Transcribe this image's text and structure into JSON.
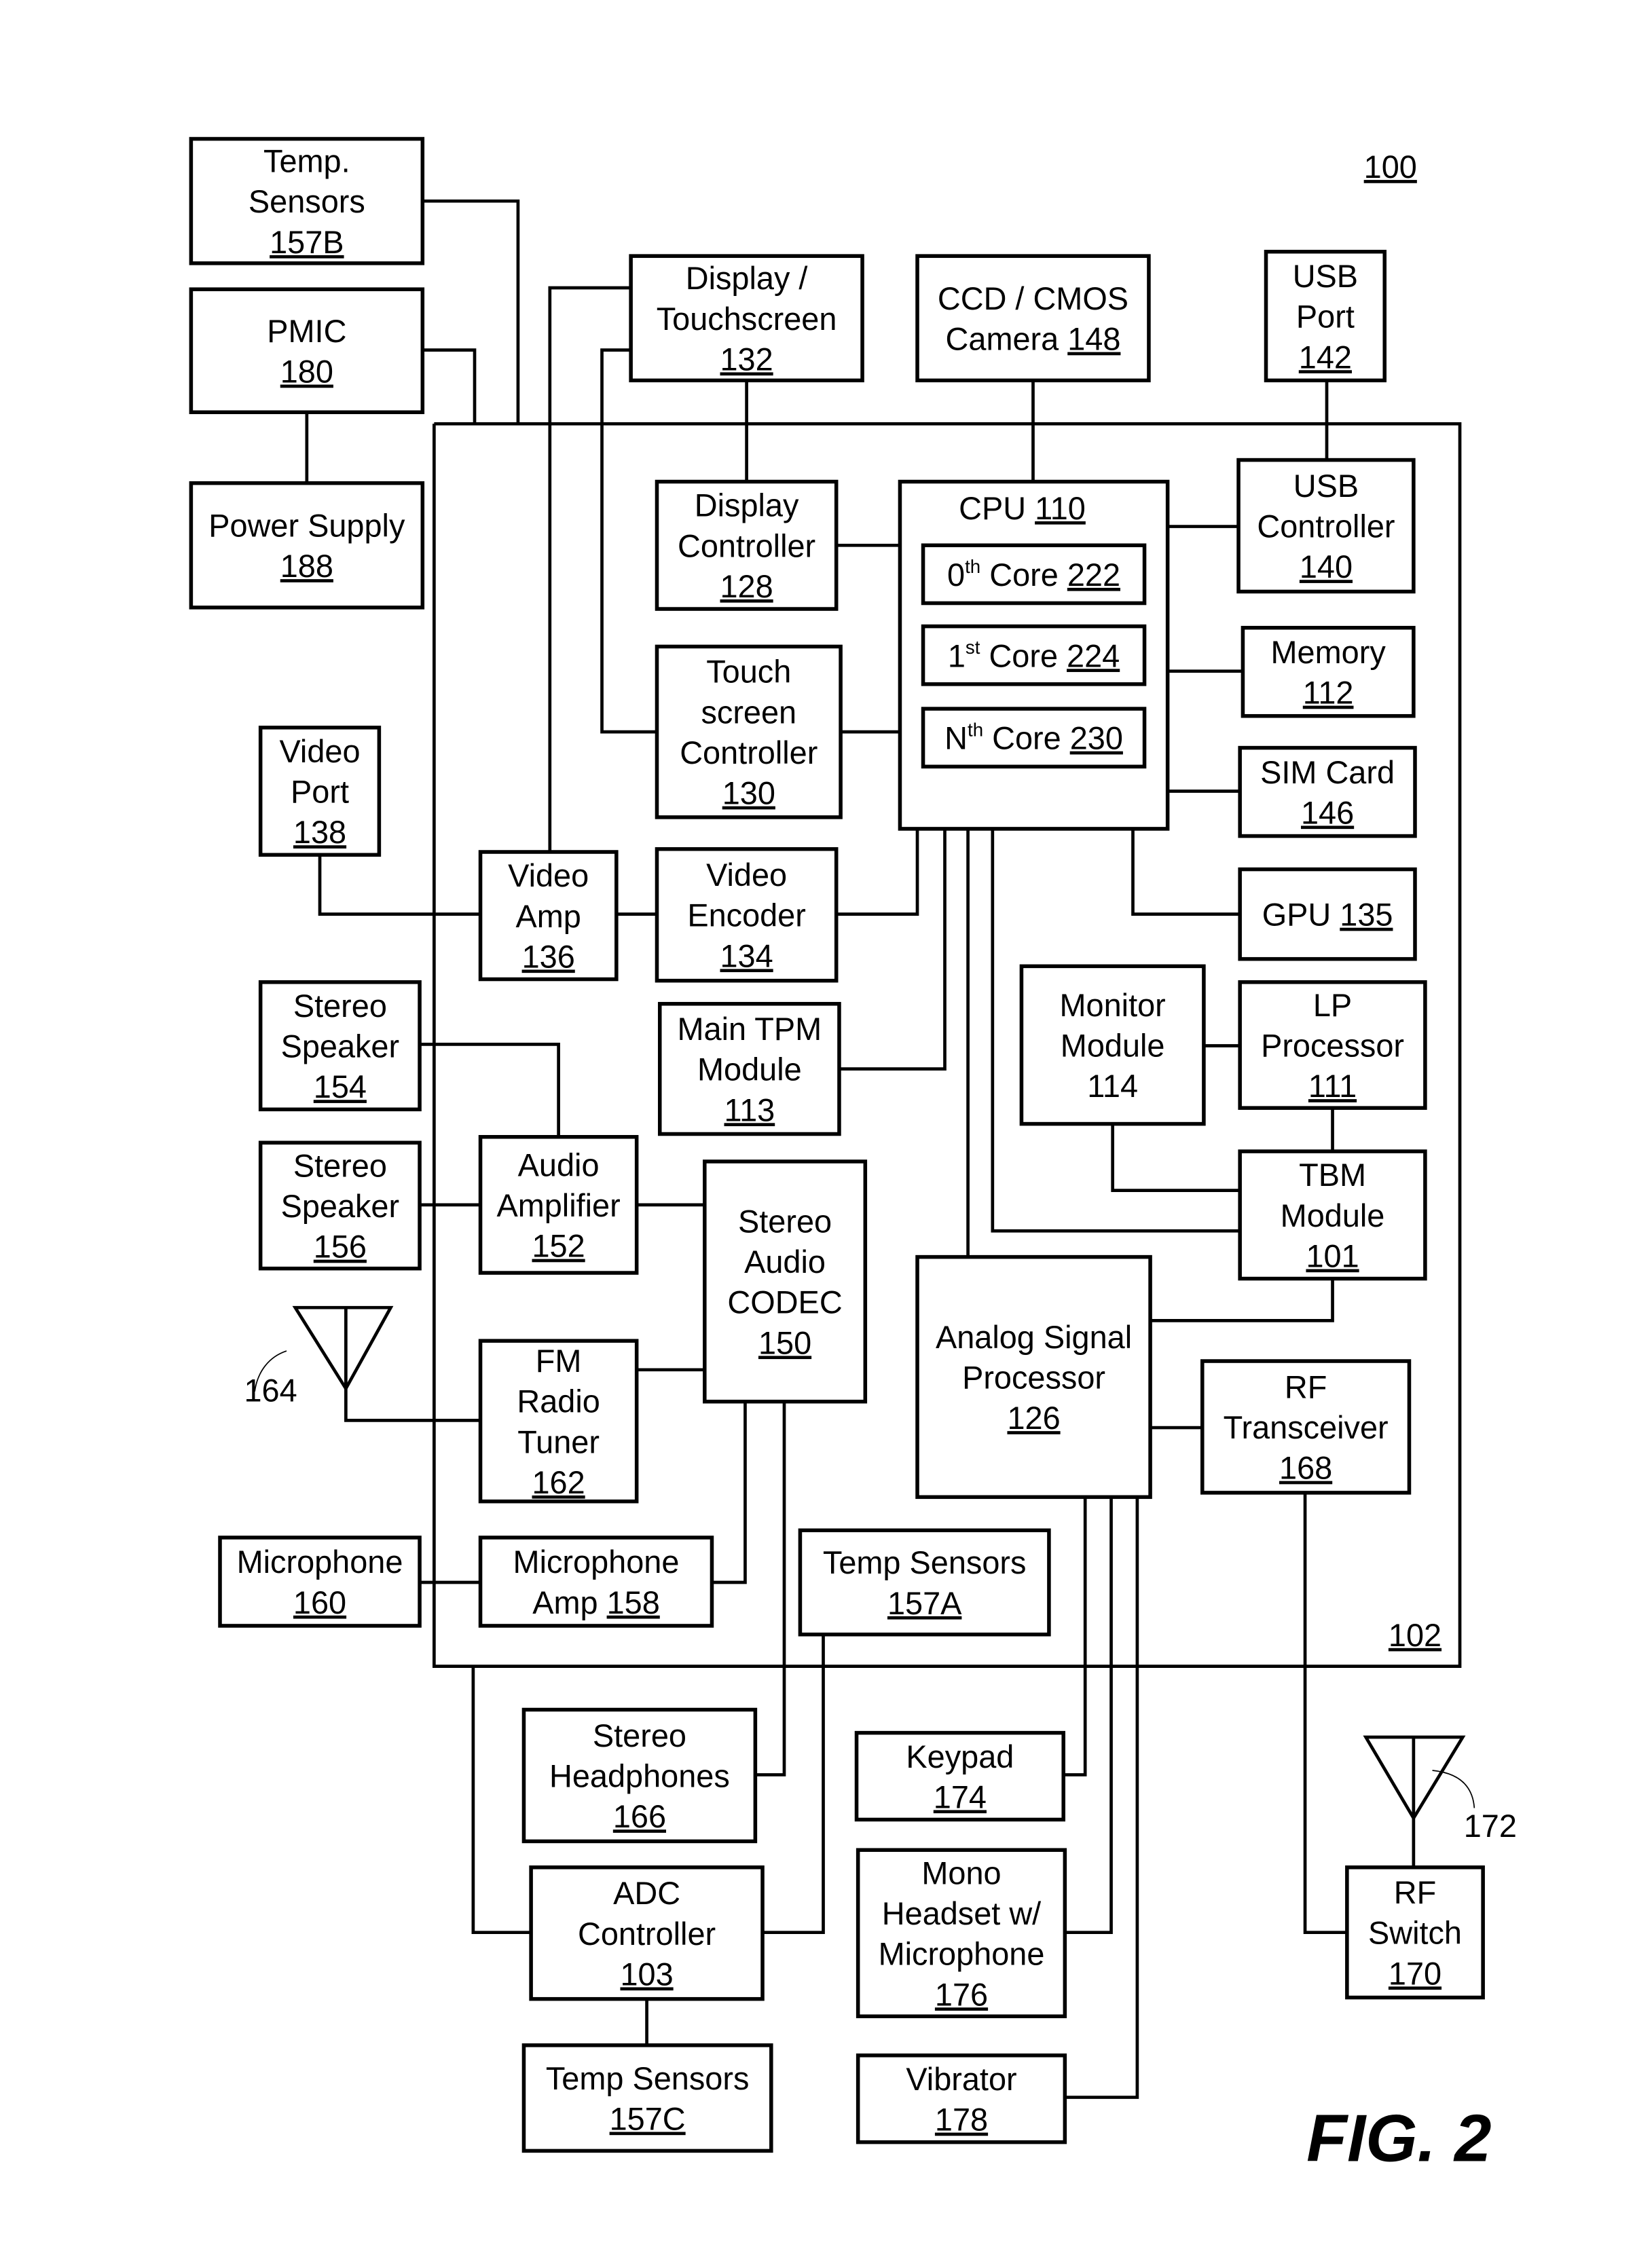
{
  "figure": {
    "title": "FIG. 2",
    "system_ref": "100",
    "chip_ref": "102"
  },
  "blocks": [
    {
      "id": "temp-sensors-157b",
      "lines": [
        "Temp.",
        "Sensors"
      ],
      "ref": "157B"
    },
    {
      "id": "pmic",
      "lines": [
        "PMIC"
      ],
      "ref": "180"
    },
    {
      "id": "power-supply",
      "lines": [
        "Power Supply"
      ],
      "ref": "188"
    },
    {
      "id": "display-touchscreen",
      "lines": [
        "Display /",
        "Touchscreen"
      ],
      "ref": "132"
    },
    {
      "id": "camera",
      "lines": [
        "CCD / CMOS"
      ],
      "inline_label": "Camera",
      "ref": "148"
    },
    {
      "id": "usb-port",
      "lines": [
        "USB",
        "Port"
      ],
      "ref": "142"
    },
    {
      "id": "display-controller",
      "lines": [
        "Display",
        "Controller"
      ],
      "ref": "128"
    },
    {
      "id": "touchscreen-controller",
      "lines": [
        "Touch",
        "screen",
        "Controller"
      ],
      "ref": "130"
    },
    {
      "id": "cpu",
      "inline_label": "CPU",
      "ref": "110"
    },
    {
      "id": "core-0",
      "ordinal": "0",
      "ordinal_suffix": "th",
      "inline_label": "Core",
      "ref": "222"
    },
    {
      "id": "core-1",
      "ordinal": "1",
      "ordinal_suffix": "st",
      "inline_label": "Core",
      "ref": "224"
    },
    {
      "id": "core-n",
      "ordinal": "N",
      "ordinal_suffix": "th",
      "inline_label": "Core",
      "ref": "230"
    },
    {
      "id": "usb-controller",
      "lines": [
        "USB",
        "Controller"
      ],
      "ref": "140"
    },
    {
      "id": "memory",
      "lines": [
        "Memory"
      ],
      "ref": "112"
    },
    {
      "id": "sim-card",
      "lines": [
        "SIM Card"
      ],
      "ref": "146"
    },
    {
      "id": "gpu",
      "inline_label": "GPU",
      "ref": "135"
    },
    {
      "id": "video-port",
      "lines": [
        "Video",
        "Port"
      ],
      "ref": "138"
    },
    {
      "id": "video-amp",
      "lines": [
        "Video",
        "Amp"
      ],
      "ref": "136"
    },
    {
      "id": "video-encoder",
      "lines": [
        "Video",
        "Encoder"
      ],
      "ref": "134"
    },
    {
      "id": "main-tpm-module",
      "lines": [
        "Main TPM",
        "Module"
      ],
      "ref": "113"
    },
    {
      "id": "monitor-module",
      "lines": [
        "Monitor",
        "Module",
        "114"
      ],
      "ref": ""
    },
    {
      "id": "lp-processor",
      "lines": [
        "LP",
        "Processor"
      ],
      "ref": "111"
    },
    {
      "id": "tbm-module",
      "lines": [
        "TBM",
        "Module"
      ],
      "ref": "101"
    },
    {
      "id": "stereo-speaker-154",
      "lines": [
        "Stereo",
        "Speaker"
      ],
      "ref": "154"
    },
    {
      "id": "stereo-speaker-156",
      "lines": [
        "Stereo",
        "Speaker"
      ],
      "ref": "156"
    },
    {
      "id": "audio-amplifier",
      "lines": [
        "Audio",
        "Amplifier"
      ],
      "ref": "152"
    },
    {
      "id": "stereo-audio-codec",
      "lines": [
        "Stereo",
        "Audio",
        "CODEC"
      ],
      "ref": "150"
    },
    {
      "id": "fm-radio-tuner",
      "lines": [
        "FM",
        "Radio",
        "Tuner"
      ],
      "ref": "162"
    },
    {
      "id": "analog-signal-processor",
      "lines": [
        "Analog Signal",
        "Processor"
      ],
      "ref": "126"
    },
    {
      "id": "rf-transceiver",
      "lines": [
        "RF",
        "Transceiver"
      ],
      "ref": "168"
    },
    {
      "id": "microphone",
      "lines": [
        "Microphone"
      ],
      "ref": "160"
    },
    {
      "id": "microphone-amp",
      "lines": [
        "Microphone"
      ],
      "inline_label": "Amp",
      "ref": "158"
    },
    {
      "id": "temp-sensors-157a",
      "lines": [
        "Temp Sensors"
      ],
      "ref": "157A"
    },
    {
      "id": "stereo-headphones",
      "lines": [
        "Stereo",
        "Headphones"
      ],
      "ref": "166"
    },
    {
      "id": "keypad",
      "lines": [
        "Keypad"
      ],
      "ref": "174"
    },
    {
      "id": "adc-controller",
      "lines": [
        "ADC",
        "Controller"
      ],
      "ref": "103"
    },
    {
      "id": "mono-headset",
      "lines": [
        "Mono",
        "Headset w/",
        "Microphone"
      ],
      "ref": "176"
    },
    {
      "id": "temp-sensors-157c",
      "lines": [
        "Temp Sensors"
      ],
      "ref": "157C"
    },
    {
      "id": "vibrator",
      "lines": [
        "Vibrator"
      ],
      "ref": "178"
    },
    {
      "id": "rf-switch",
      "lines": [
        "RF",
        "Switch"
      ],
      "ref": "170"
    }
  ],
  "antennas": [
    {
      "id": "fm-antenna",
      "ref": "164"
    },
    {
      "id": "rf-antenna",
      "ref": "172"
    }
  ]
}
